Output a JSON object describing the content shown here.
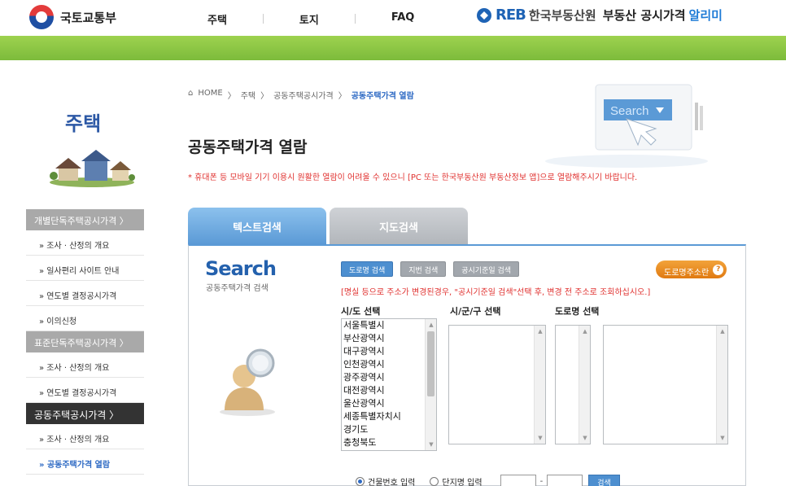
{
  "header": {
    "ministry_name": "국토교통부",
    "nav": [
      "주택",
      "토지",
      "FAQ"
    ],
    "reb_mark": "RE",
    "reb_mark_b": "B",
    "reb_name": "한국부동산원",
    "service_title": "부동산 공시가격",
    "service_accent": "알리미"
  },
  "sidebar": {
    "title": "주택",
    "menu": [
      {
        "type": "cat",
        "label": "개별단독주택공시가격  〉"
      },
      {
        "type": "sub",
        "label": "»  조사 · 산정의 개요"
      },
      {
        "type": "sub",
        "label": "»  일사편리 사이트 안내"
      },
      {
        "type": "sub",
        "label": "»  연도별 결정공시가격"
      },
      {
        "type": "sub",
        "label": "»  이의신청"
      },
      {
        "type": "cat",
        "label": "표준단독주택공시가격  〉"
      },
      {
        "type": "sub",
        "label": "»  조사 · 산정의 개요"
      },
      {
        "type": "sub",
        "label": "»  연도별 결정공시가격"
      },
      {
        "type": "cat-active",
        "label": "공동주택공시가격        〉"
      },
      {
        "type": "sub",
        "label": "»  조사 · 산정의 개요"
      },
      {
        "type": "sub-current",
        "label": "»  공동주택가격 열람"
      }
    ]
  },
  "breadcrumb": [
    "HOME",
    "주택",
    "공동주택공시가격",
    "공동주택가격 열람"
  ],
  "page_title": "공동주택가격 열람",
  "notice": "* 휴대폰 등 모바일 기기 이용시 원활한 열람이 어려울 수 있으니 [PC 또는 한국부동산원 부동산정보 앱]으로 열람해주시기 바랍니다.",
  "head_illust_text": "Search",
  "tabs": {
    "text": "텍스트검색",
    "map": "지도검색"
  },
  "search": {
    "word": "Search",
    "sub": "공동주택가격 검색",
    "btn_road": "도로명 검색",
    "btn_lot": "지번 검색",
    "btn_date": "공시기준일 검색",
    "road_info": "도로명주소란",
    "help": "?",
    "warn": "[명실 등으로 주소가 변경된경우, \"공시기준일 검색\"선택 후, 변경 전 주소로 조회하십시오.]",
    "label_sido": "시/도 선택",
    "label_sigungu": "시/군/구 선택",
    "label_road": "도로명 선택",
    "sido_options": [
      "서울특별시",
      "부산광역시",
      "대구광역시",
      "인천광역시",
      "광주광역시",
      "대전광역시",
      "울산광역시",
      "세종특별자치시",
      "경기도",
      "충청북도"
    ],
    "radio_building": "건물번호 입력",
    "radio_complex": "단지명 입력",
    "dash": "-",
    "go": "검색"
  },
  "colors": {
    "accent_blue": "#2e6ac4",
    "green_bar": "#8cc744",
    "warn_red": "#e0312f"
  }
}
